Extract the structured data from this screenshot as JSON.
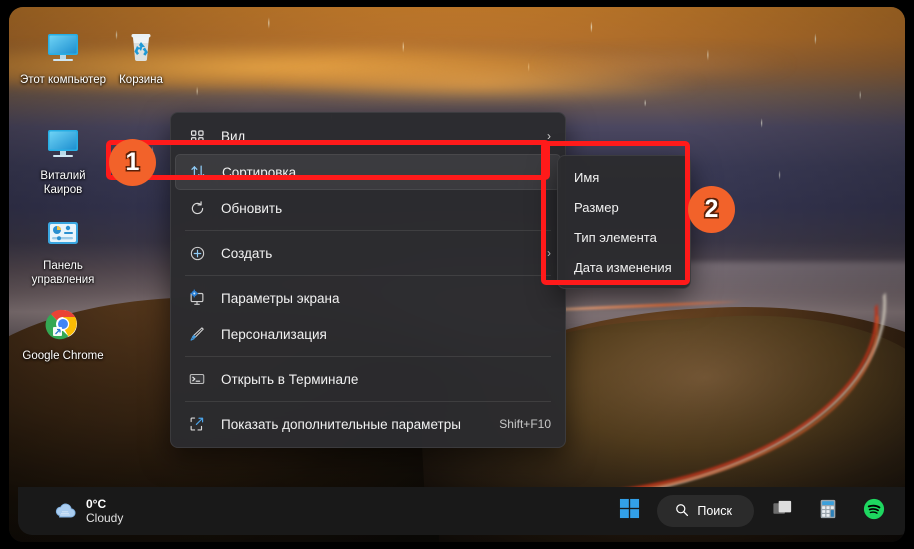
{
  "desktop": {
    "icons": [
      {
        "name": "this-pc",
        "label": "Этот компьютер",
        "icon": "monitor-icon"
      },
      {
        "name": "recycle-bin",
        "label": "Корзина",
        "icon": "recycle-bin-icon"
      },
      {
        "name": "user-vitaliy",
        "label": "Виталий Каиров",
        "icon": "monitor-icon"
      },
      {
        "name": "control-panel",
        "label": "Панель управления",
        "icon": "control-panel-icon"
      },
      {
        "name": "google-chrome",
        "label": "Google Chrome",
        "icon": "chrome-icon"
      }
    ]
  },
  "context_menu": {
    "items": [
      {
        "label": "Вид",
        "icon": "grid-view-icon",
        "arrow": "›",
        "accel": "",
        "selected": false,
        "sep_after": false
      },
      {
        "label": "Сортировка",
        "icon": "sort-arrows-icon",
        "arrow": "›",
        "accel": "",
        "selected": true,
        "sep_after": false
      },
      {
        "label": "Обновить",
        "icon": "refresh-icon",
        "arrow": "",
        "accel": "",
        "selected": false,
        "sep_after": true
      },
      {
        "label": "Создать",
        "icon": "plus-circle-icon",
        "arrow": "›",
        "accel": "",
        "selected": false,
        "sep_after": true
      },
      {
        "label": "Параметры экрана",
        "icon": "display-settings-icon",
        "arrow": "",
        "accel": "",
        "selected": false,
        "sep_after": false
      },
      {
        "label": "Персонализация",
        "icon": "brush-icon",
        "arrow": "",
        "accel": "",
        "selected": false,
        "sep_after": true
      },
      {
        "label": "Открыть в Терминале",
        "icon": "terminal-icon",
        "arrow": "",
        "accel": "",
        "selected": false,
        "sep_after": true
      },
      {
        "label": "Показать дополнительные параметры",
        "icon": "expand-options-icon",
        "arrow": "",
        "accel": "Shift+F10",
        "selected": false,
        "sep_after": false
      }
    ]
  },
  "sub_menu": {
    "items": [
      {
        "label": "Имя"
      },
      {
        "label": "Размер"
      },
      {
        "label": "Тип элемента"
      },
      {
        "label": "Дата изменения"
      }
    ]
  },
  "annotations": {
    "badge_1": "1",
    "badge_2": "2",
    "accent_color": "#ff1a1a",
    "badge_color": "#f2622a"
  },
  "taskbar": {
    "weather": {
      "temperature": "0°C",
      "condition": "Cloudy",
      "icon": "cloud-icon"
    },
    "start_button": {
      "name": "start-button",
      "icon": "windows-logo-icon"
    },
    "search": {
      "label": "Поиск",
      "icon": "search-icon"
    },
    "buttons": [
      {
        "name": "task-view-button",
        "icon": "task-view-icon"
      },
      {
        "name": "calculator-button",
        "icon": "calculator-icon"
      },
      {
        "name": "spotify-button",
        "icon": "spotify-icon"
      }
    ]
  }
}
